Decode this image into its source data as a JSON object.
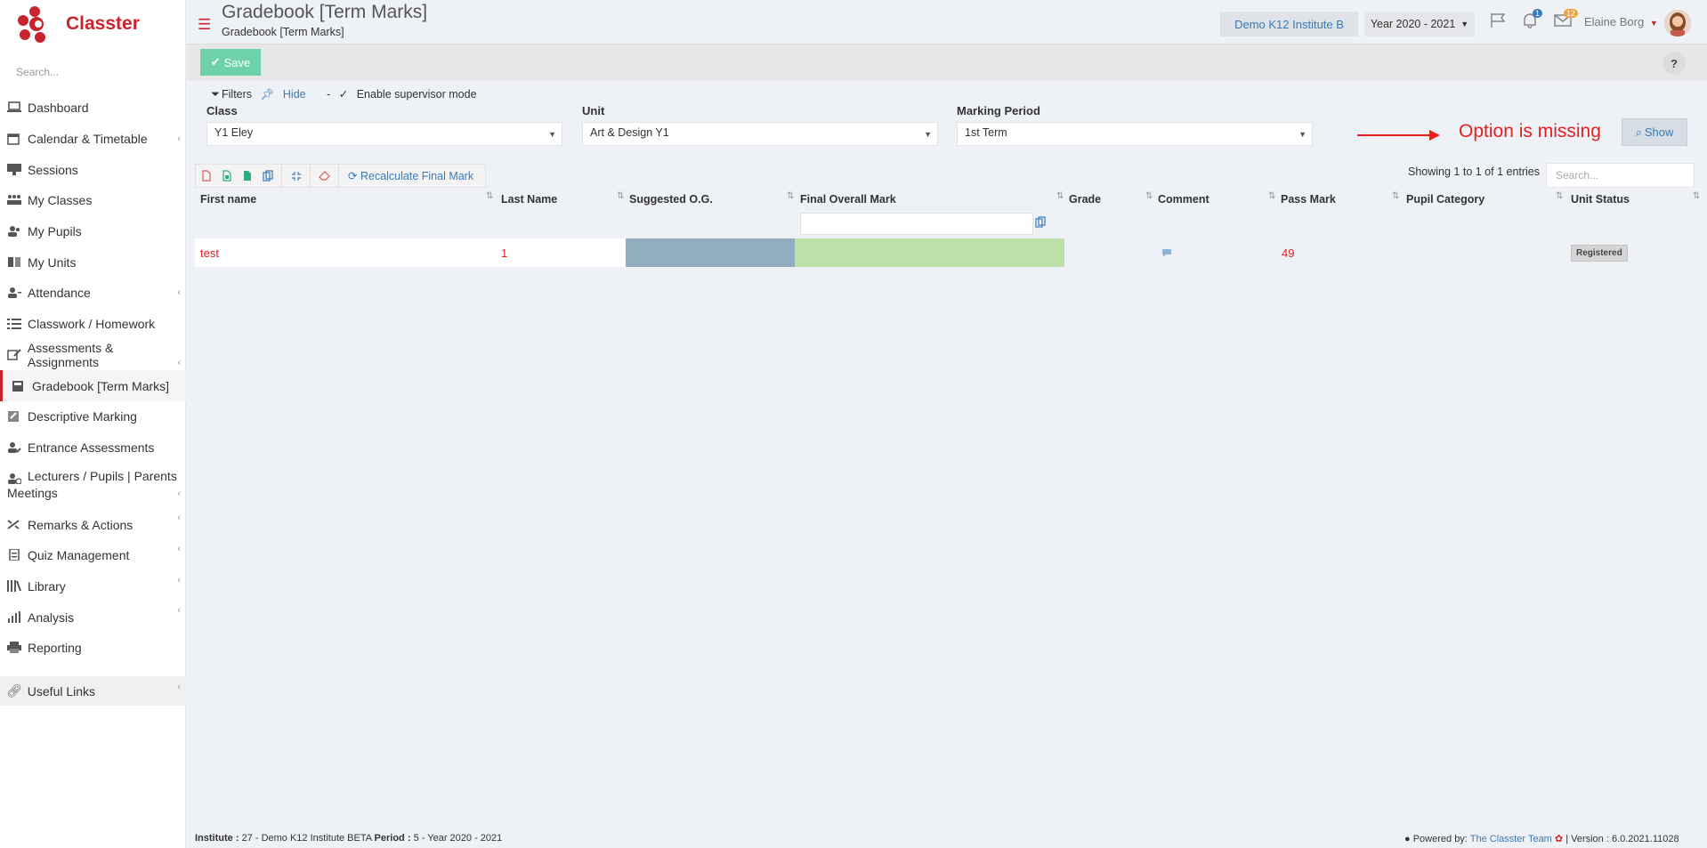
{
  "app": {
    "brand": "Classter",
    "brand_color": "#c8242e"
  },
  "sidebar": {
    "search_placeholder": "Search...",
    "items": [
      {
        "label": "Dashboard",
        "icon": "laptop-icon"
      },
      {
        "label": "Calendar & Timetable",
        "icon": "calendar-icon",
        "has_submenu": true
      },
      {
        "label": "Sessions",
        "icon": "projector-icon"
      },
      {
        "label": "My Classes",
        "icon": "users-grid-icon"
      },
      {
        "label": "My Pupils",
        "icon": "users-icon"
      },
      {
        "label": "My Units",
        "icon": "book-icon"
      },
      {
        "label": "Attendance",
        "icon": "user-check-icon",
        "has_submenu": true
      },
      {
        "label": "Classwork / Homework",
        "icon": "list-check-icon"
      },
      {
        "label": "Assessments & Assignments",
        "icon": "edit-icon",
        "has_submenu": true
      },
      {
        "label": "Gradebook [Term Marks]",
        "icon": "gradebook-icon",
        "active": true
      },
      {
        "label": "Descriptive Marking",
        "icon": "pen-square-icon"
      },
      {
        "label": "Entrance Assessments",
        "icon": "user-edit-icon"
      },
      {
        "label": "Lecturers / Pupils | Parents Meetings",
        "icon": "user-clock-icon",
        "has_submenu": true
      },
      {
        "label": "Remarks & Actions",
        "icon": "shuffle-icon",
        "has_submenu": true
      },
      {
        "label": "Quiz Management",
        "icon": "clipboard-icon",
        "has_submenu": true
      },
      {
        "label": "Library",
        "icon": "library-icon",
        "has_submenu": true
      },
      {
        "label": "Analysis",
        "icon": "bar-chart-icon",
        "has_submenu": true
      },
      {
        "label": "Reporting",
        "icon": "printer-icon"
      }
    ],
    "useful_links": "Useful Links"
  },
  "header": {
    "title": "Gradebook [Term Marks]",
    "breadcrumb": "Gradebook [Term Marks]",
    "institute": "Demo K12 Institute B",
    "year": "Year 2020 - 2021",
    "notifications_count": "1",
    "messages_count": "12",
    "user_name": "Elaine Borg"
  },
  "toolbar": {
    "save_label": "Save",
    "help_label": "?"
  },
  "filters": {
    "filters_label": "Filters",
    "hide_label": "Hide",
    "separator": "-",
    "supervisor_label": "Enable supervisor mode",
    "class_label": "Class",
    "class_value": "Y1 Eley",
    "unit_label": "Unit",
    "unit_value": "Art & Design Y1",
    "period_label": "Marking Period",
    "period_value": "1st Term",
    "show_label": "Show"
  },
  "annotation": {
    "text": "Option is missing",
    "color": "#e41f1f"
  },
  "table": {
    "recalc_label": "Recalculate Final Mark",
    "showing_text": "Showing 1 to 1 of 1 entries",
    "search_placeholder": "Search...",
    "columns": [
      "First name",
      "Last Name",
      "Suggested O.G.",
      "Final Overall Mark",
      "Grade",
      "Comment",
      "Pass Mark",
      "Pupil Category",
      "Unit Status"
    ],
    "rows": [
      {
        "first_name": "test",
        "last_name": "1",
        "suggested_og": "",
        "final_mark": "",
        "grade": "",
        "pass_mark": "49",
        "pupil_category": "",
        "unit_status": "Registered"
      }
    ]
  },
  "footer": {
    "institute_label": "Institute :",
    "institute_value": "27 - Demo K12 Institute BETA",
    "period_label": "Period :",
    "period_value": "5 - Year 2020 - 2021",
    "powered": "Powered by:",
    "team": "The Classter Team",
    "version": "| Version : 6.0.2021.11028"
  }
}
